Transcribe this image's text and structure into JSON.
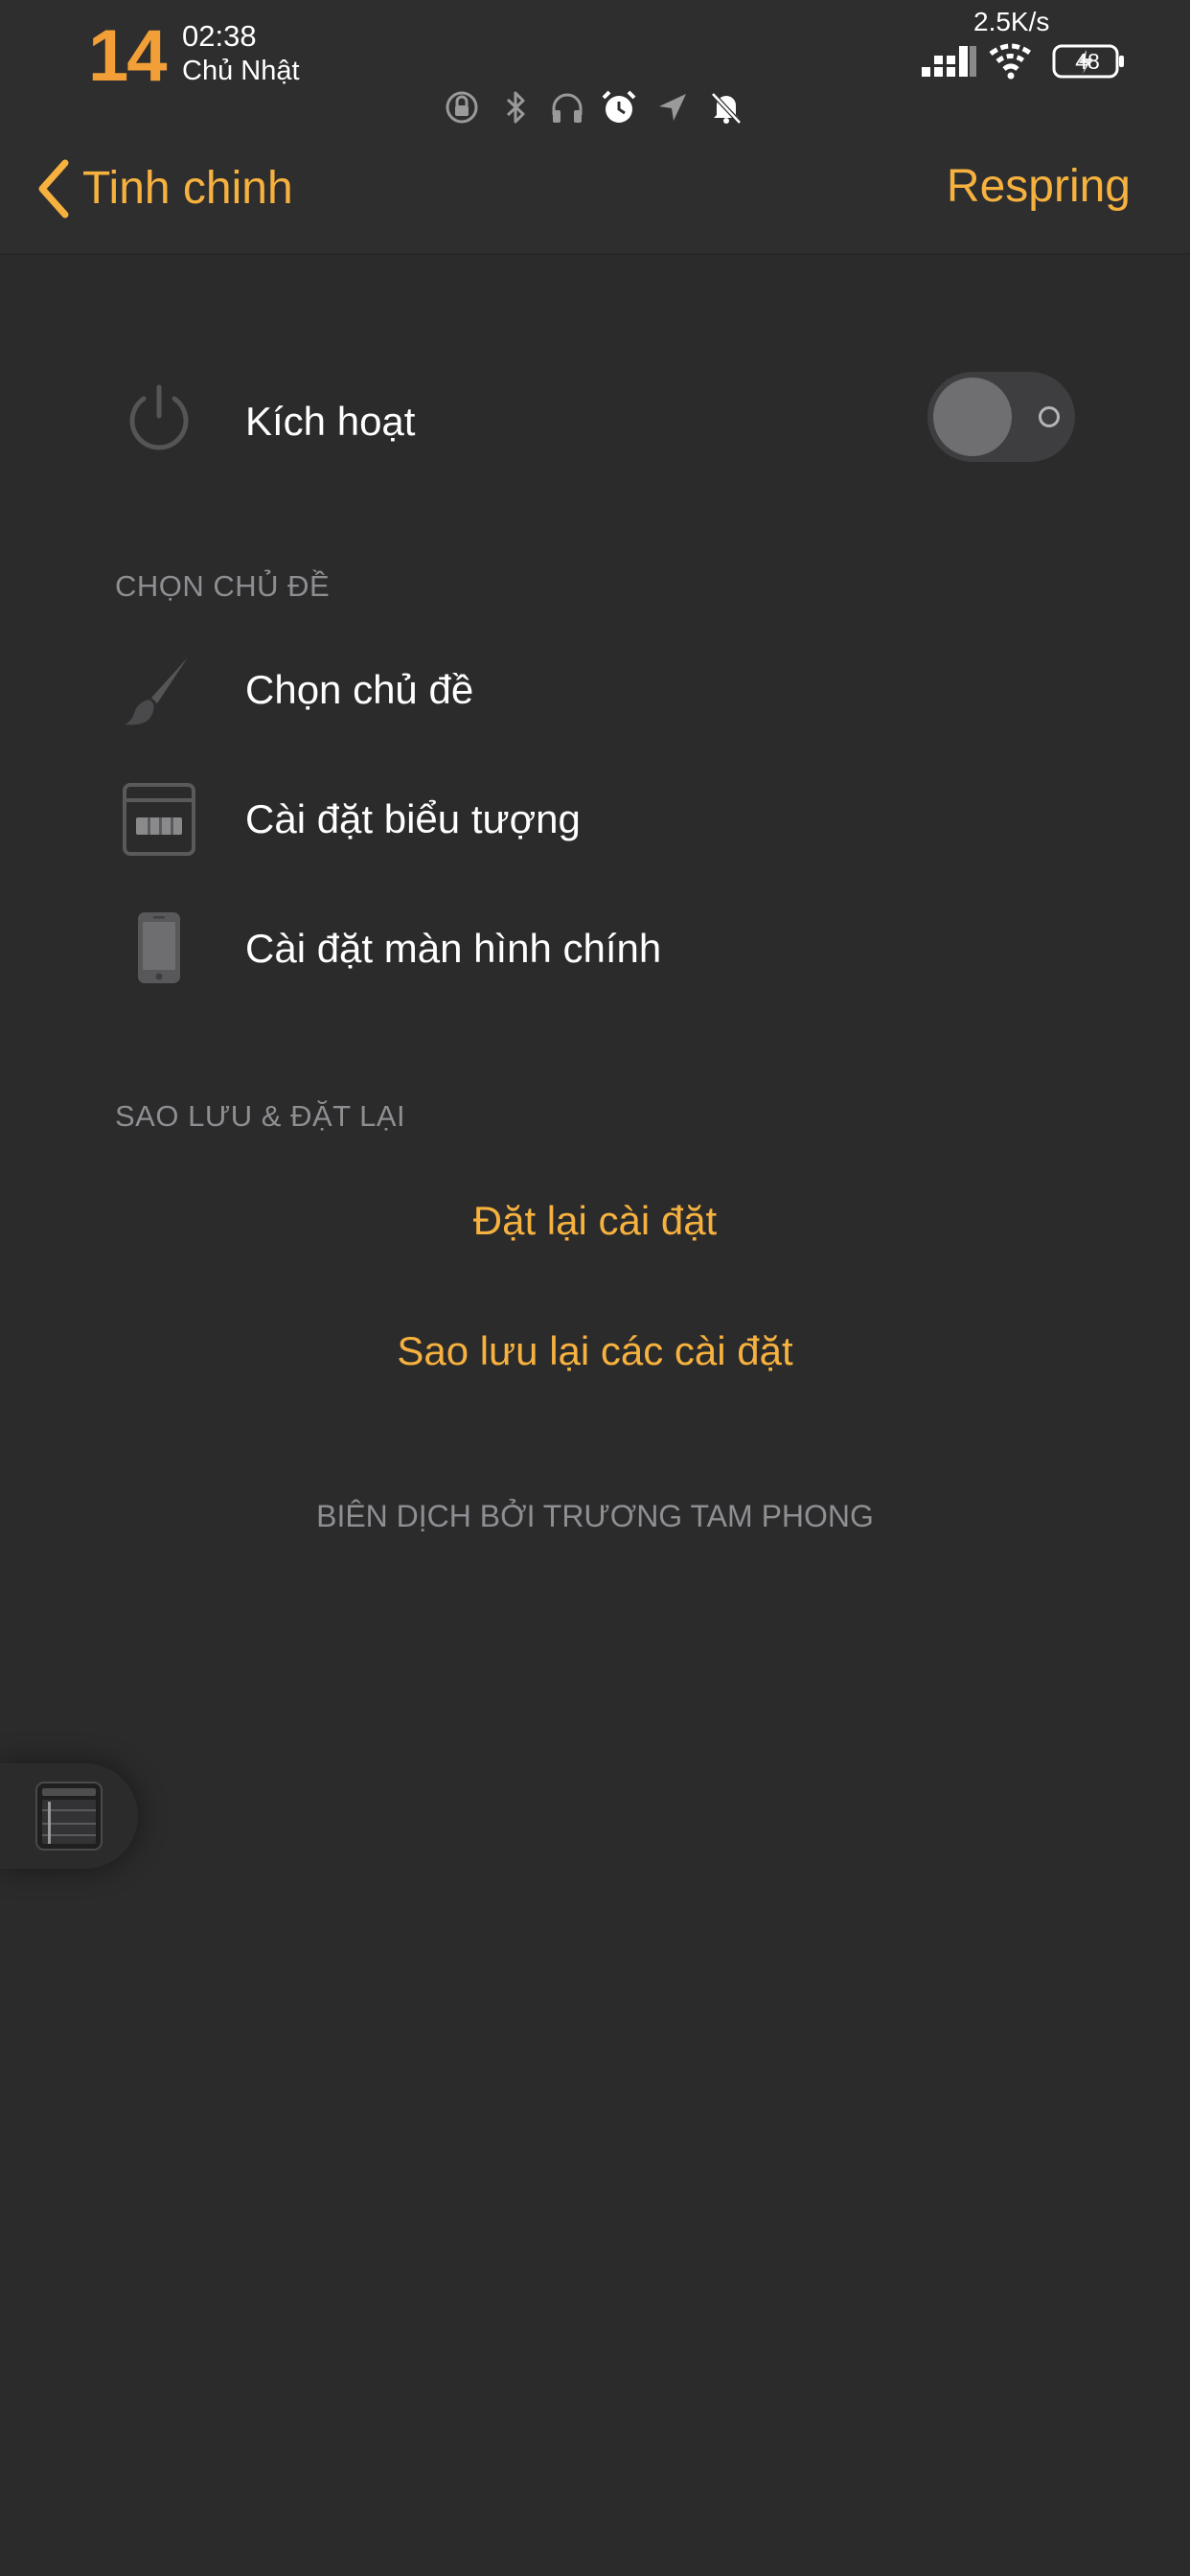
{
  "status_bar": {
    "day_number": "14",
    "time": "02:38",
    "day_name": "Chủ Nhật",
    "net_speed": "2.5K/s",
    "battery_level": "48",
    "icons": [
      "orientation-lock-icon",
      "bluetooth-icon",
      "headphones-icon",
      "alarm-icon",
      "location-icon",
      "bell-muted-icon"
    ]
  },
  "nav": {
    "back_label": "Tinh chinh",
    "action_label": "Respring"
  },
  "main": {
    "enable_row": {
      "label": "Kích hoạt",
      "icon": "power-icon",
      "toggle_on": false
    },
    "theme_section": {
      "header": "CHỌN CHỦ ĐỀ",
      "items": [
        {
          "label": "Chọn chủ đề",
          "icon": "paintbrush-icon"
        },
        {
          "label": "Cài đặt biểu tượng",
          "icon": "icon-grid-icon"
        },
        {
          "label": "Cài đặt màn hình chính",
          "icon": "phone-icon"
        }
      ]
    },
    "backup_section": {
      "header": "SAO LƯU & ĐẶT LẠI",
      "actions": [
        {
          "label": "Đặt lại cài đặt"
        },
        {
          "label": "Sao lưu lại các cài đặt"
        }
      ]
    },
    "footer": "BIÊN DỊCH BỞI TRƯƠNG TAM PHONG"
  },
  "floating_button": {
    "icon": "app-switcher-icon"
  },
  "colors": {
    "background": "#2b2b2b",
    "bar": "#2e2e2e",
    "accent": "#f6b13f",
    "day_number": "#f29f38",
    "secondary_text": "#8e8e93"
  }
}
